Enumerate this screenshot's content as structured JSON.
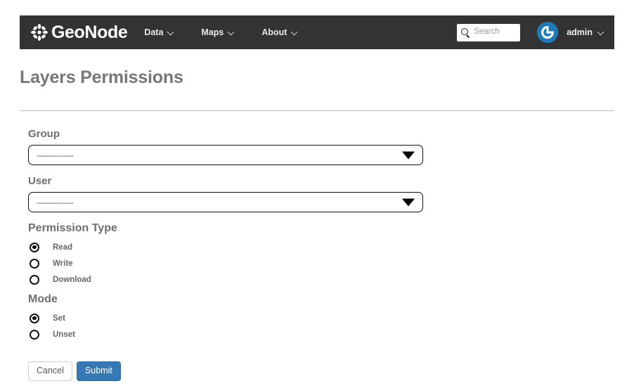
{
  "navbar": {
    "brand": {
      "text": "GeoNode",
      "logo_icon": "geonode-asterisk-logo-icon"
    },
    "items": [
      {
        "label": "Data",
        "icon": "chevron-down-icon"
      },
      {
        "label": "Maps",
        "icon": "chevron-down-icon"
      },
      {
        "label": "About",
        "icon": "chevron-down-icon"
      }
    ],
    "search": {
      "placeholder": "Search",
      "value": "",
      "icon": "search-icon"
    },
    "user": {
      "name": "admin",
      "avatar_icon": "power-button-avatar-icon",
      "menu_icon": "chevron-down-icon"
    },
    "colors": {
      "background": "#333333",
      "avatar": "#1f7ab8"
    }
  },
  "page": {
    "title": "Layers Permissions"
  },
  "form": {
    "group": {
      "label": "Group",
      "selected": "---------------",
      "arrow_icon": "triangle-down-icon"
    },
    "user": {
      "label": "User",
      "selected": "---------------",
      "arrow_icon": "triangle-down-icon"
    },
    "permission_type": {
      "label": "Permission Type",
      "options": [
        {
          "label": "Read",
          "checked": true
        },
        {
          "label": "Write",
          "checked": false
        },
        {
          "label": "Download",
          "checked": false
        }
      ]
    },
    "mode": {
      "label": "Mode",
      "options": [
        {
          "label": "Set",
          "checked": true
        },
        {
          "label": "Unset",
          "checked": false
        }
      ]
    },
    "buttons": {
      "cancel": "Cancel",
      "submit": "Submit"
    }
  },
  "colors": {
    "primary": "#337ab7",
    "title_gray": "#777777",
    "label_gray": "#6e6e6e"
  }
}
